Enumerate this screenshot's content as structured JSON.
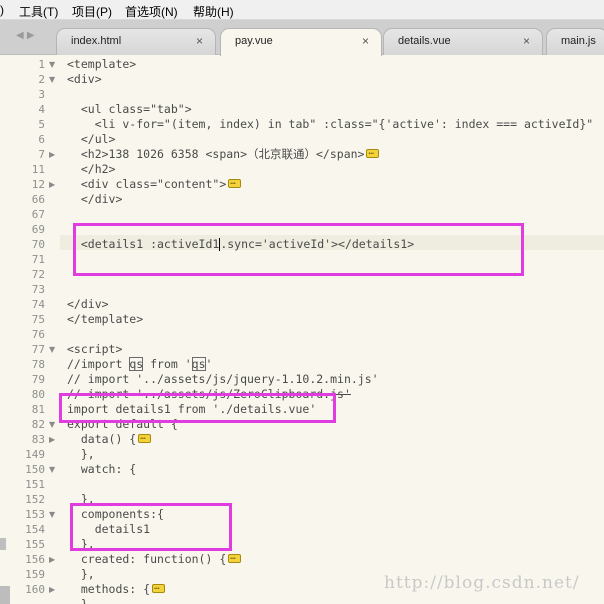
{
  "menu": {
    "items": [
      ")",
      "工具(T)",
      "项目(P)",
      "首选项(N)",
      "帮助(H)"
    ]
  },
  "tabs": [
    {
      "label": "index.html",
      "close": "×",
      "active": false
    },
    {
      "label": "pay.vue",
      "close": "×",
      "active": true
    },
    {
      "label": "details.vue",
      "close": "×",
      "active": false
    },
    {
      "label": "main.js",
      "close": "",
      "active": false
    }
  ],
  "nav": {
    "arrows": "◀ ▶"
  },
  "lines": [
    {
      "num": "1",
      "fold": "▼",
      "text": "<template>"
    },
    {
      "num": "2",
      "fold": "▼",
      "text": "<div>"
    },
    {
      "num": "3",
      "fold": "",
      "text": ""
    },
    {
      "num": "4",
      "fold": "",
      "text": "  <ul class=\"tab\">"
    },
    {
      "num": "5",
      "fold": "",
      "text": "    <li v-for=\"(item, index) in tab\" :class=\"{'active': index === activeId}\""
    },
    {
      "num": "6",
      "fold": "",
      "text": "  </ul>"
    },
    {
      "num": "7",
      "fold": "▶",
      "text": "  <h2>138 1026 6358 <span>（北京联通）</span>"
    },
    {
      "num": "11",
      "fold": "",
      "text": "  </h2>"
    },
    {
      "num": "12",
      "fold": "▶",
      "text": "  <div class=\"content\">"
    },
    {
      "num": "66",
      "fold": "",
      "text": "  </div>"
    },
    {
      "num": "67",
      "fold": "",
      "text": ""
    },
    {
      "num": "69",
      "fold": "",
      "text": ""
    },
    {
      "num": "70",
      "fold": "",
      "text": "  <details1 :activeId1",
      "after": ".sync='activeId'></details1>"
    },
    {
      "num": "71",
      "fold": "",
      "text": ""
    },
    {
      "num": "72",
      "fold": "",
      "text": ""
    },
    {
      "num": "73",
      "fold": "",
      "text": ""
    },
    {
      "num": "74",
      "fold": "",
      "text": "</div>"
    },
    {
      "num": "75",
      "fold": "",
      "text": "</template>"
    },
    {
      "num": "76",
      "fold": "",
      "text": ""
    },
    {
      "num": "77",
      "fold": "▼",
      "text": "<script>"
    },
    {
      "num": "78",
      "fold": "",
      "text": "//import ",
      "box1": "qs",
      "mid": " from '",
      "box2": "qs",
      "end": "'"
    },
    {
      "num": "79",
      "fold": "",
      "text": "// import '../assets/js/jquery-1.10.2.min.js'"
    },
    {
      "num": "80",
      "fold": "",
      "text": "// import '../assets/js/ZeroClipboard.js'"
    },
    {
      "num": "81",
      "fold": "",
      "text": "import details1 from './details.vue'"
    },
    {
      "num": "82",
      "fold": "▼",
      "text": "export default {"
    },
    {
      "num": "83",
      "fold": "▶",
      "text": "  data() {"
    },
    {
      "num": "149",
      "fold": "",
      "text": "  },"
    },
    {
      "num": "150",
      "fold": "▼",
      "text": "  watch: {"
    },
    {
      "num": "151",
      "fold": "",
      "text": ""
    },
    {
      "num": "152",
      "fold": "",
      "text": "  },"
    },
    {
      "num": "153",
      "fold": "▼",
      "text": "  components:{"
    },
    {
      "num": "154",
      "fold": "",
      "text": "    details1"
    },
    {
      "num": "155",
      "fold": "",
      "text": "  },"
    },
    {
      "num": "156",
      "fold": "▶",
      "text": "  created: function() {"
    },
    {
      "num": "159",
      "fold": "",
      "text": "  },"
    },
    {
      "num": "160",
      "fold": "▶",
      "text": "  methods: {"
    },
    {
      "num": "",
      "fold": "",
      "text": "  }"
    }
  ],
  "watermark": "http://blog.csdn.net/",
  "colors": {
    "annotation": "#e03ce0",
    "background": "#f9f7ed"
  }
}
